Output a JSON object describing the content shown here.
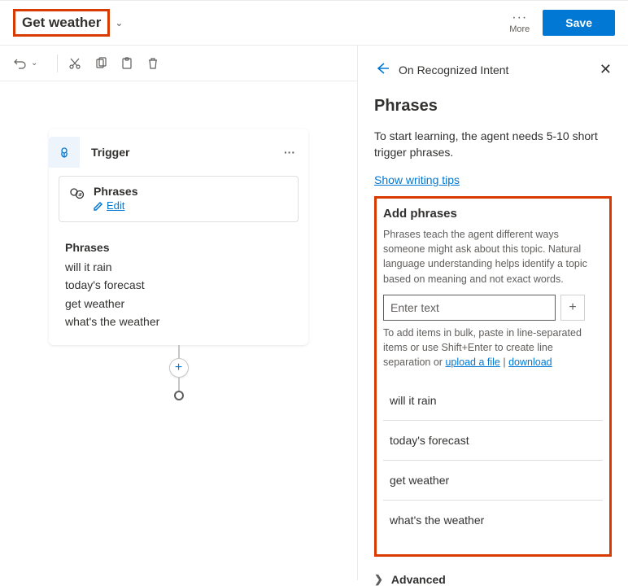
{
  "top": {
    "title": "Get weather",
    "more_label": "More",
    "save_label": "Save"
  },
  "canvas": {
    "trigger": {
      "title": "Trigger",
      "phrases_heading": "Phrases",
      "edit_label": "Edit",
      "list_heading": "Phrases",
      "items": [
        "will it rain",
        "today's forecast",
        "get weather",
        "what's the weather"
      ]
    }
  },
  "panel": {
    "breadcrumb": "On Recognized Intent",
    "heading": "Phrases",
    "subheading": "To start learning, the agent needs 5-10 short trigger phrases.",
    "tips_link": "Show writing tips",
    "add_section": {
      "title": "Add phrases",
      "description": "Phrases teach the agent different ways someone might ask about this topic. Natural language understanding helps identify a topic based on meaning and not exact words.",
      "placeholder": "Enter text",
      "bulk_prefix": "To add items in bulk, paste in line-separated items or use Shift+Enter to create line separation or ",
      "upload_link": "upload a file",
      "download_link": "download",
      "items": [
        "will it rain",
        "today's forecast",
        "get weather",
        "what's the weather"
      ]
    },
    "advanced_label": "Advanced"
  }
}
